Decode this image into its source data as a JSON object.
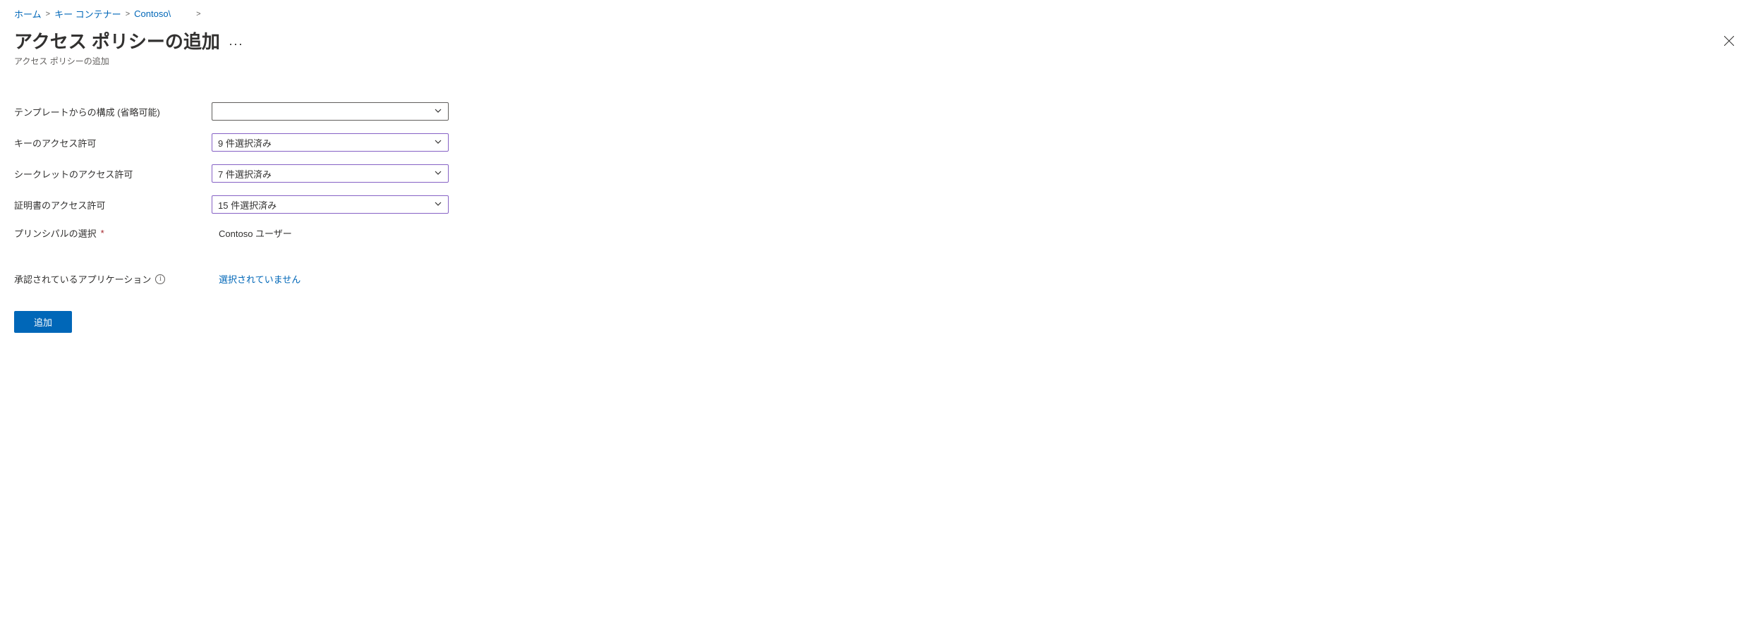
{
  "breadcrumb": {
    "items": [
      {
        "label": "ホーム"
      },
      {
        "label": "キー コンテナー"
      },
      {
        "label": "Contoso\\"
      }
    ],
    "separator": ">"
  },
  "header": {
    "title": "アクセス ポリシーの追加",
    "subtitle": "アクセス ポリシーの追加",
    "more": "···"
  },
  "form": {
    "template": {
      "label": "テンプレートからの構成 (省略可能)",
      "value": ""
    },
    "keyPermissions": {
      "label": "キーのアクセス許可",
      "value": "9 件選択済み"
    },
    "secretPermissions": {
      "label": "シークレットのアクセス許可",
      "value": "7 件選択済み"
    },
    "certPermissions": {
      "label": "証明書のアクセス許可",
      "value": "15 件選択済み"
    },
    "principal": {
      "label": "プリンシパルの選択",
      "required": "*",
      "value": "Contoso ユーザー"
    },
    "authorizedApp": {
      "label": "承認されているアプリケーション",
      "value": "選択されていません"
    },
    "addButton": "追加"
  },
  "icons": {
    "info": "i"
  }
}
